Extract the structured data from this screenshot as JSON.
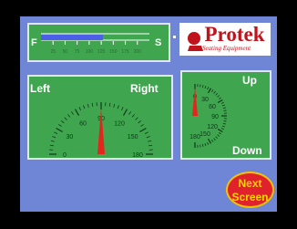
{
  "progress": {
    "start_label": "F",
    "end_label": "S",
    "fill_fraction": 0.57,
    "ticks": [
      "25",
      "50",
      "75",
      "100",
      "125",
      "150",
      "175",
      "200"
    ]
  },
  "logo": {
    "name": "Protek",
    "tagline": "Seating Equipment"
  },
  "left_gauge": {
    "left_label": "Left",
    "right_label": "Right",
    "ticks": [
      "0",
      "30",
      "60",
      "90",
      "120",
      "150",
      "180"
    ],
    "value": 90
  },
  "right_gauge": {
    "up_label": "Up",
    "down_label": "Down",
    "ticks": [
      "0",
      "30",
      "60",
      "90",
      "120",
      "150",
      "180"
    ],
    "value": 0
  },
  "next_button": {
    "label_line1": "Next",
    "label_line2": "Screen"
  },
  "colors": {
    "screen": "#6f85d6",
    "panel": "#3fa64f",
    "needle": "#e3261d",
    "brand_red": "#c0141c",
    "button_text": "#ffd400"
  }
}
